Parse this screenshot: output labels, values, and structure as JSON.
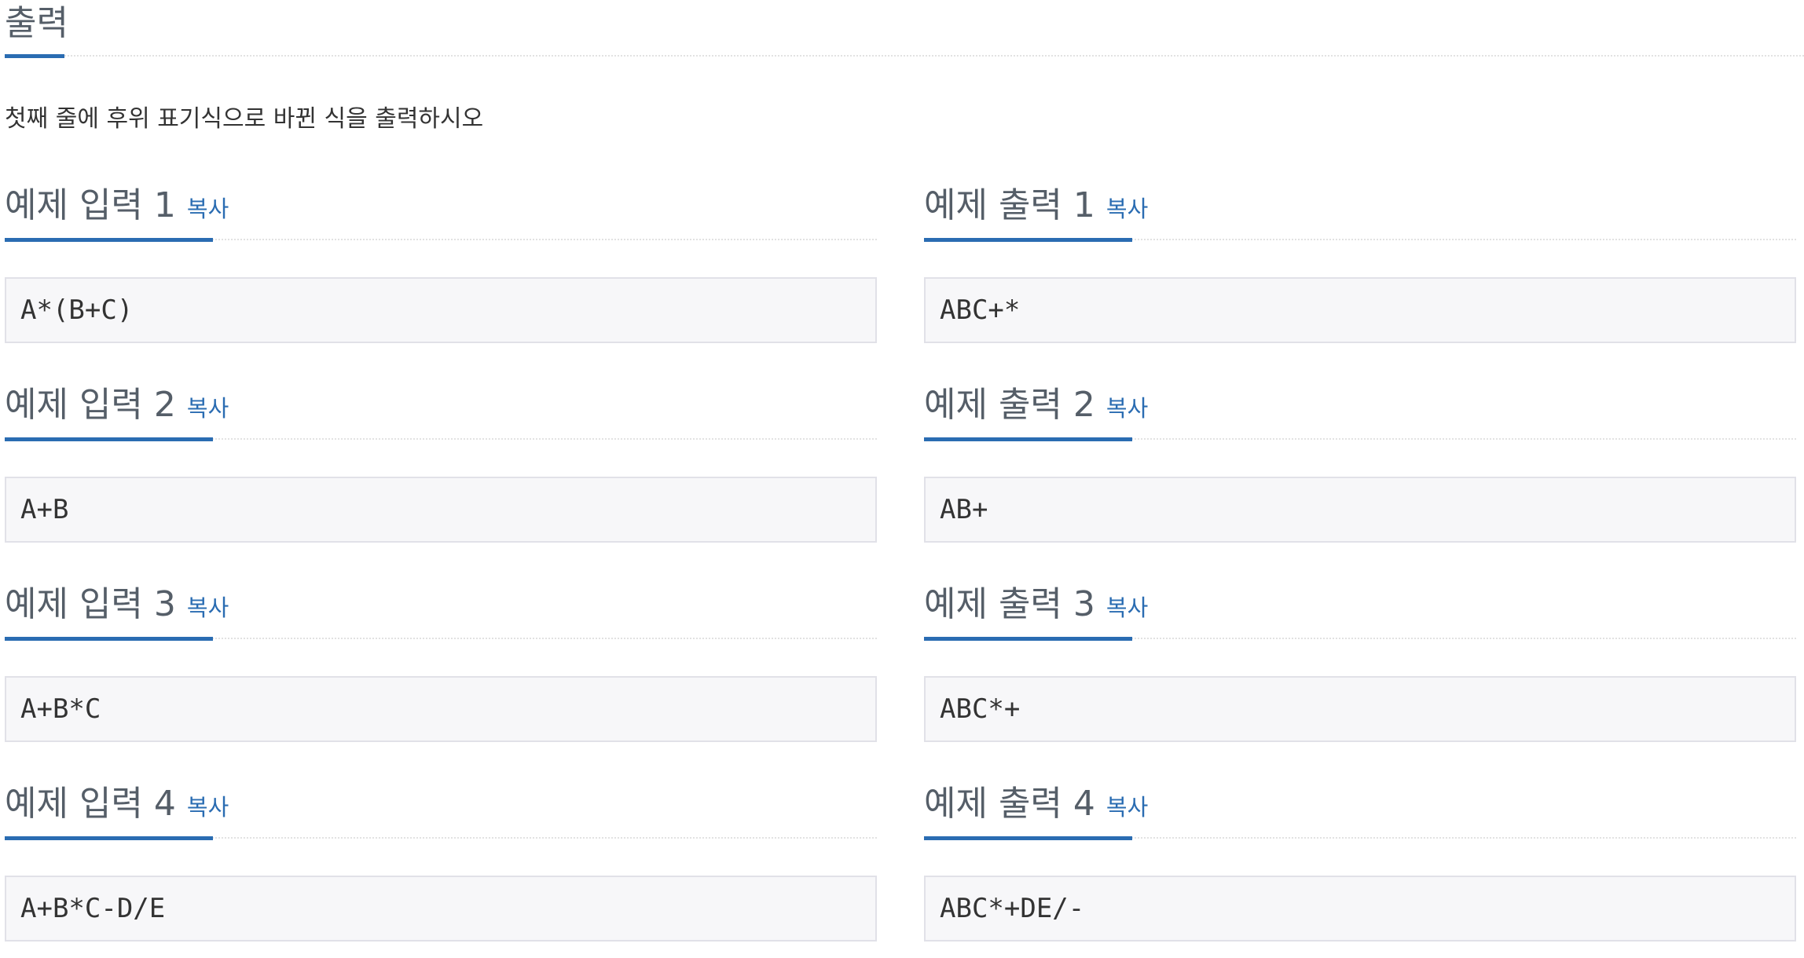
{
  "section": {
    "title": "출력",
    "description": "첫째 줄에 후위 표기식으로 바뀐 식을 출력하시오"
  },
  "samples": [
    {
      "input_title": "예제 입력 1",
      "output_title": "예제 출력 1",
      "copy_label": "복사",
      "input": "A*(B+C)",
      "output": "ABC+*"
    },
    {
      "input_title": "예제 입력 2",
      "output_title": "예제 출력 2",
      "copy_label": "복사",
      "input": "A+B",
      "output": "AB+"
    },
    {
      "input_title": "예제 입력 3",
      "output_title": "예제 출력 3",
      "copy_label": "복사",
      "input": "A+B*C",
      "output": "ABC*+"
    },
    {
      "input_title": "예제 입력 4",
      "output_title": "예제 출력 4",
      "copy_label": "복사",
      "input": "A+B*C-D/E",
      "output": "ABC*+DE/-"
    }
  ],
  "colors": {
    "accent": "#2a6cb2",
    "code_background": "#f7f7f9",
    "code_border": "#e1e1e8"
  }
}
